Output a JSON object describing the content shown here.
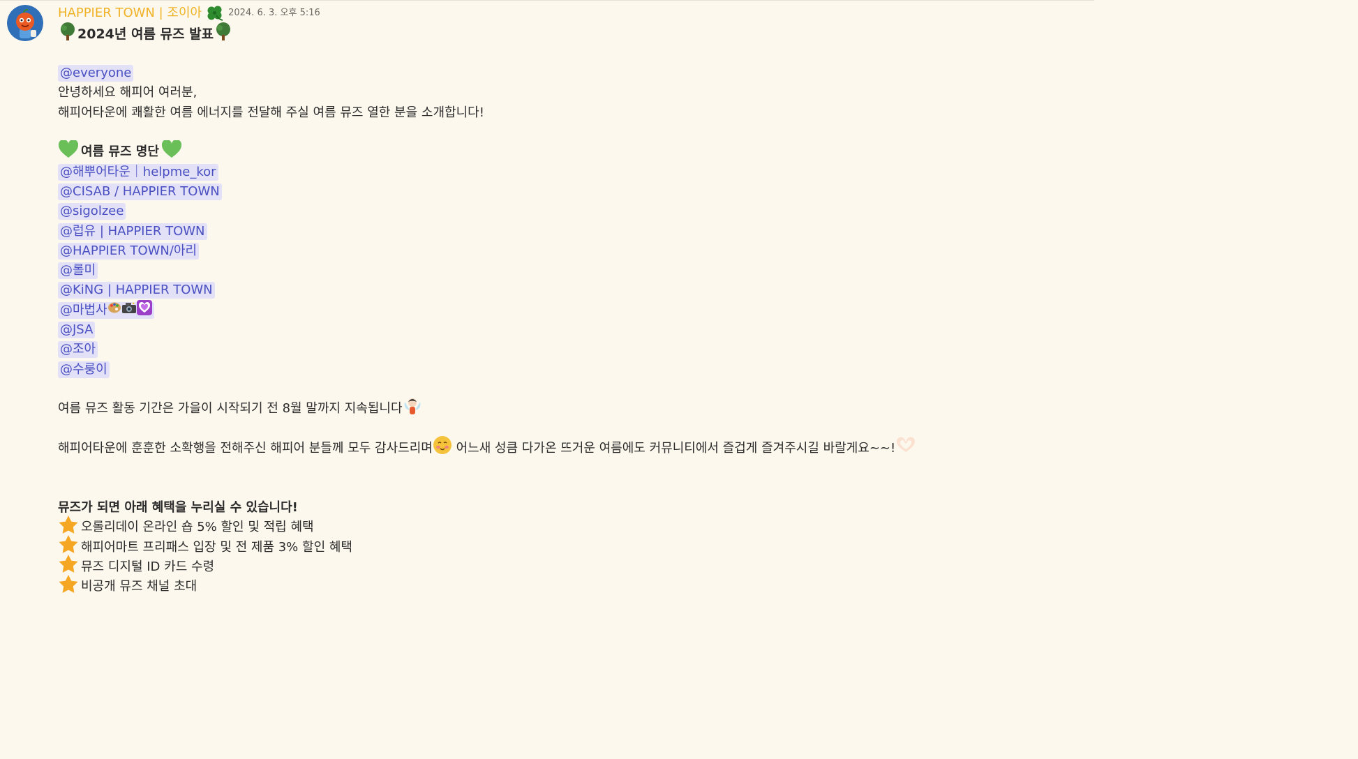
{
  "message": {
    "author": "HAPPIER TOWN | 조이아",
    "timestamp": "2024. 6. 3. 오후 5:16",
    "title": "2024년 여름 뮤즈 발표",
    "mention_everyone": "@everyone",
    "greeting": "안녕하세요 해피어 여러분,",
    "intro": "해피어타운에 쾌활한 여름 에너지를 전달해 주실 여름 뮤즈 열한 분을 소개합니다!",
    "list_title": "여름 뮤즈 명단",
    "muses": [
      "@해뿌어타운｜helpme_kor",
      "@CISAB / HAPPIER TOWN",
      "@sigolzee",
      "@럽유 | HAPPIER TOWN",
      "@HAPPIER TOWN/아리",
      "@롤미",
      "@KiNG | HAPPIER TOWN",
      "@마법사",
      "@JSA",
      "@조아",
      "@수룽이"
    ],
    "period": "여름 뮤즈 활동 기간은 가을이 시작되기 전 8월 말까지 지속됩니다",
    "thanks_a": "해피어타운에 훈훈한 소확행을 전해주신 해피어 분들께 모두 감사드리며",
    "thanks_b": " 어느새 성큼 다가온 뜨거운 여름에도 커뮤니티에서 즐겁게 즐겨주시길 바랄게요~~!",
    "benefits_title": "뮤즈가 되면 아래 혜택을 누리실 수 있습니다!",
    "benefits": [
      "오롤리데이 온라인 숍 5% 할인 및 적립 혜택",
      "해피어마트 프리패스 입장 및 전 제품 3% 할인 혜택",
      "뮤즈 디지털 ID 카드 수령",
      "비공개 뮤즈 채널 초대"
    ]
  },
  "icons": {
    "title": "tree-icon",
    "list": "green-heart-icon",
    "benefit": "star-icon",
    "author_badge": "clover-icon",
    "period": "fairy-icon",
    "thanks": "blushing-face-icon",
    "closing": "heart-hands-icon",
    "muse_extra": [
      "palette-icon",
      "camera-flash-icon",
      "heart-decoration-icon"
    ]
  },
  "colors": {
    "background": "#fdf8ee",
    "author": "#f0b224",
    "mention_bg": "#e2e1f7",
    "mention_text": "#4a50c2",
    "timestamp": "#6d6a64"
  }
}
